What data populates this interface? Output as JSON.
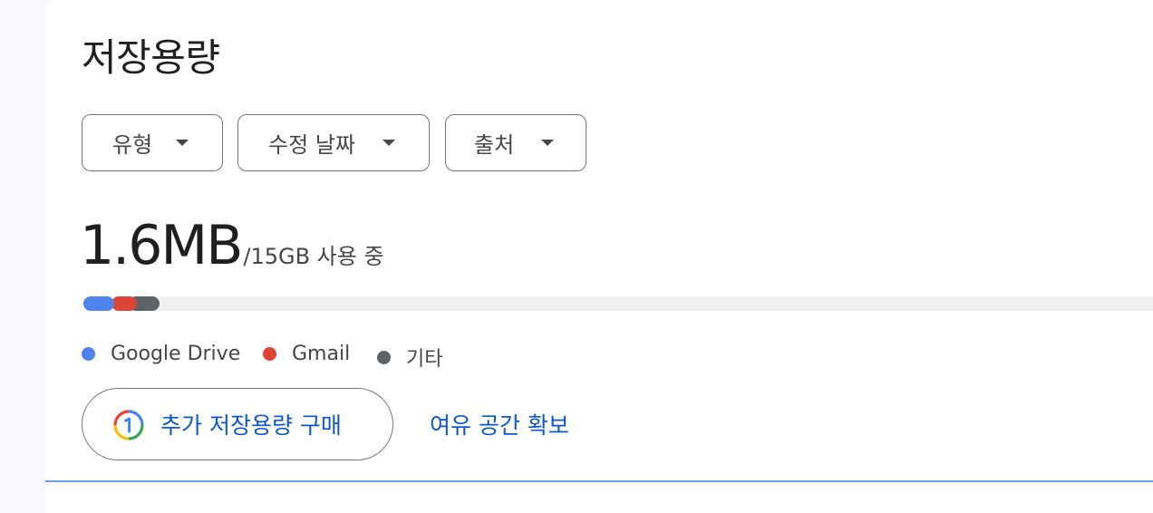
{
  "page": {
    "title": "저장용량"
  },
  "filters": [
    {
      "label": "유형"
    },
    {
      "label": "수정 날짜"
    },
    {
      "label": "출처"
    }
  ],
  "usage": {
    "used": "1.6MB",
    "total_text": "/15GB 사용 중"
  },
  "storage_breakdown": {
    "segments": [
      {
        "name": "Google Drive",
        "color": "#4e82ee"
      },
      {
        "name": "Gmail",
        "color": "#db4437"
      },
      {
        "name": "기타",
        "color": "#5f6368"
      }
    ]
  },
  "legend": [
    {
      "label": "Google Drive",
      "color": "#4e82ee"
    },
    {
      "label": "Gmail",
      "color": "#db4437"
    },
    {
      "label": "기타",
      "color": "#5f6368"
    }
  ],
  "actions": {
    "buy_label": "추가 저장용량 구매",
    "free_label": "여유 공간 확보"
  },
  "icons": {
    "filter_caret": "caret-down-icon",
    "buy": "google-one-icon"
  }
}
